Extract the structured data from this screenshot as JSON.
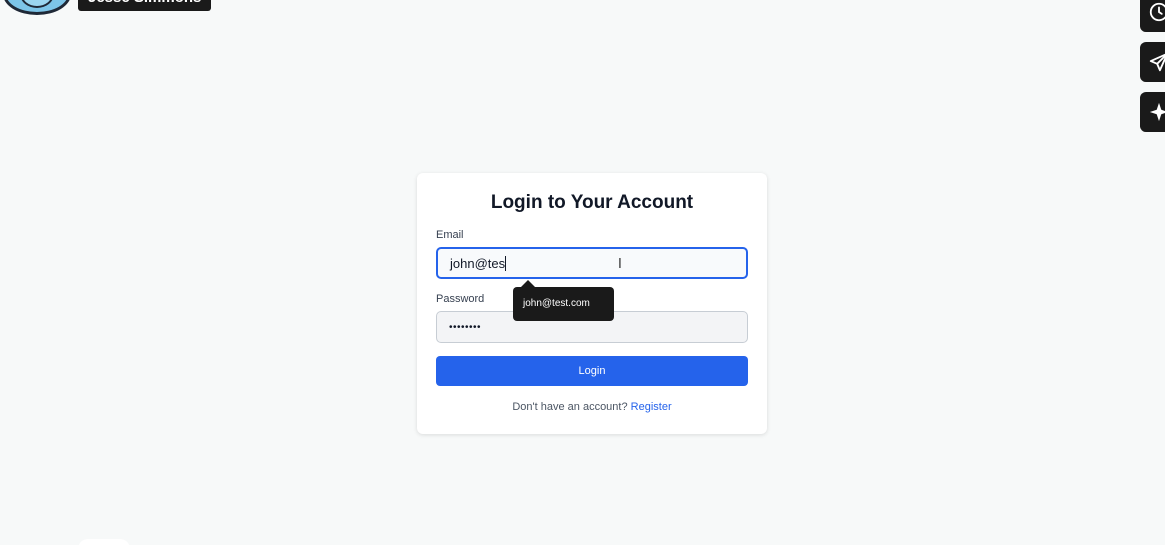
{
  "overlay": {
    "user_name": "Jesse Simmons"
  },
  "side_toolbar": {
    "icons": [
      "clock-icon",
      "send-icon",
      "sparkle-icon"
    ]
  },
  "login": {
    "title": "Login to Your Account",
    "email_label": "Email",
    "email_value": "john@tes",
    "autocomplete_suggestion": "john@test.com",
    "password_label": "Password",
    "password_value": "••••••••",
    "login_button": "Login",
    "register_prompt": "Don't have an account?",
    "register_link": "Register"
  },
  "colors": {
    "accent": "#2563eb",
    "background": "#f7f9f9",
    "tooltip": "#1a1a1a"
  }
}
